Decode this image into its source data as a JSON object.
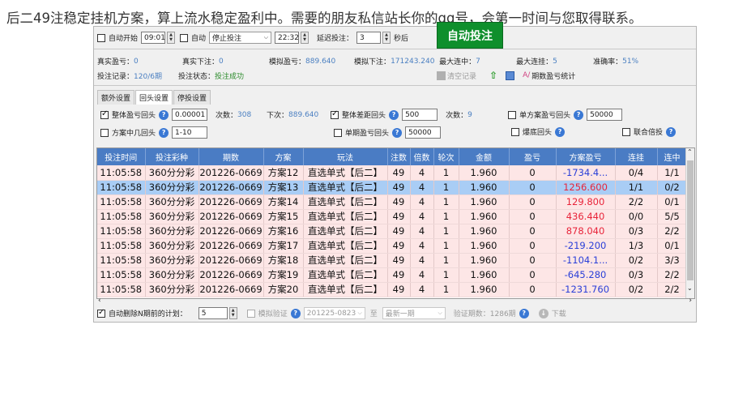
{
  "headline": "后二49注稳定挂机方案，算上流水稳定盈利中。需要的朋友私信站长你的qq号，会第一时间与您取得联系。",
  "colors": {
    "header_bg": "#4a7cc4",
    "row_bg": "#fde6e6",
    "row_selected_bg": "#a9cdf5",
    "profit_negative": "#2a3fd8",
    "profit_positive": "#e8243a",
    "green_button": "#0f8f2c"
  },
  "toolbar": {
    "auto_start_label": "自动开始",
    "start_time": "09:01",
    "auto_label": "自动",
    "stop_mode": "停止投注",
    "stop_time": "22:32",
    "delay_label": "延迟投注：",
    "delay_value": "3",
    "seconds_label": "秒后",
    "green_button_label": "自动投注"
  },
  "stats": {
    "real_profit_label": "真实盈亏：",
    "real_profit_value": "0",
    "real_bet_label": "真实下注：",
    "real_bet_value": "0",
    "sim_profit_label": "模拟盈亏：",
    "sim_profit_value": "889.640",
    "sim_bet_label": "模拟下注：",
    "sim_bet_value": "171243.240",
    "max_streak_win_label": "最大连中：",
    "max_streak_win_value": "7",
    "max_streak_loss_label": "最大连挂：",
    "max_streak_loss_value": "5",
    "accuracy_label": "准确率：",
    "accuracy_value": "51%",
    "bet_record_label": "投注记录：",
    "bet_record_value": "120/6期",
    "bet_status_label": "投注状态：",
    "bet_status_value": "投注成功",
    "clear_records_label": "清空记录",
    "period_stats_label": "期数盈亏统计"
  },
  "tabs": [
    "额外设置",
    "回头设置",
    "停投设置"
  ],
  "settings": {
    "overall_profit_back_label": "整体盈亏回头",
    "overall_profit_back_value": "0.00001",
    "count_label": "次数：",
    "count_value_1": "308",
    "next_label": "下次：",
    "next_value": "889.640",
    "overall_diff_back_label": "整体差距回头",
    "overall_diff_back_value": "500",
    "count_value_2": "9",
    "single_plan_back_label": "单方案盈亏回头",
    "single_plan_back_value": "50000",
    "plan_hit_back_label": "方案中几回头",
    "plan_hit_back_value": "1-10",
    "single_period_back_label": "单期盈亏回头",
    "single_period_back_value": "50000",
    "bottom_out_label": "爆底回头",
    "combined_multiplier_label": "联合倍投"
  },
  "table": {
    "columns": [
      "投注时间",
      "投注彩种",
      "期数",
      "方案",
      "玩法",
      "注数",
      "倍数",
      "轮次",
      "金额",
      "盈亏",
      "方案盈亏",
      "连挂",
      "连中"
    ],
    "rows": [
      [
        "11:05:58",
        "360分分彩",
        "201226-0669",
        "方案12",
        "直选单式【后二】",
        "49",
        "4",
        "1",
        "1.960",
        "0",
        "-1734.4...",
        "0/4",
        "1/1"
      ],
      [
        "11:05:58",
        "360分分彩",
        "201226-0669",
        "方案13",
        "直选单式【后二】",
        "49",
        "4",
        "1",
        "1.960",
        "0",
        "1256.600",
        "1/1",
        "0/2"
      ],
      [
        "11:05:58",
        "360分分彩",
        "201226-0669",
        "方案14",
        "直选单式【后二】",
        "49",
        "4",
        "1",
        "1.960",
        "0",
        "129.800",
        "2/2",
        "0/1"
      ],
      [
        "11:05:58",
        "360分分彩",
        "201226-0669",
        "方案15",
        "直选单式【后二】",
        "49",
        "4",
        "1",
        "1.960",
        "0",
        "436.440",
        "0/0",
        "5/5"
      ],
      [
        "11:05:58",
        "360分分彩",
        "201226-0669",
        "方案16",
        "直选单式【后二】",
        "49",
        "4",
        "1",
        "1.960",
        "0",
        "878.040",
        "0/3",
        "2/2"
      ],
      [
        "11:05:58",
        "360分分彩",
        "201226-0669",
        "方案17",
        "直选单式【后二】",
        "49",
        "4",
        "1",
        "1.960",
        "0",
        "-219.200",
        "1/3",
        "0/1"
      ],
      [
        "11:05:58",
        "360分分彩",
        "201226-0669",
        "方案18",
        "直选单式【后二】",
        "49",
        "4",
        "1",
        "1.960",
        "0",
        "-1104.1...",
        "0/2",
        "3/3"
      ],
      [
        "11:05:58",
        "360分分彩",
        "201226-0669",
        "方案19",
        "直选单式【后二】",
        "49",
        "4",
        "1",
        "1.960",
        "0",
        "-645.280",
        "0/3",
        "2/2"
      ],
      [
        "11:05:58",
        "360分分彩",
        "201226-0669",
        "方案20",
        "直选单式【后二】",
        "49",
        "4",
        "1",
        "1.960",
        "0",
        "-1231.760",
        "0/2",
        "2/2"
      ]
    ],
    "selected_row": 1
  },
  "bottom": {
    "auto_delete_label": "自动删除N期前的计划：",
    "auto_delete_value": "5",
    "sim_verify_label": "模拟验证",
    "from_period": "201225-0823",
    "to_label": "至",
    "to_period": "最新一期",
    "verify_periods_label": "验证期数：",
    "verify_periods_value": "1286期",
    "download_label": "下载"
  }
}
